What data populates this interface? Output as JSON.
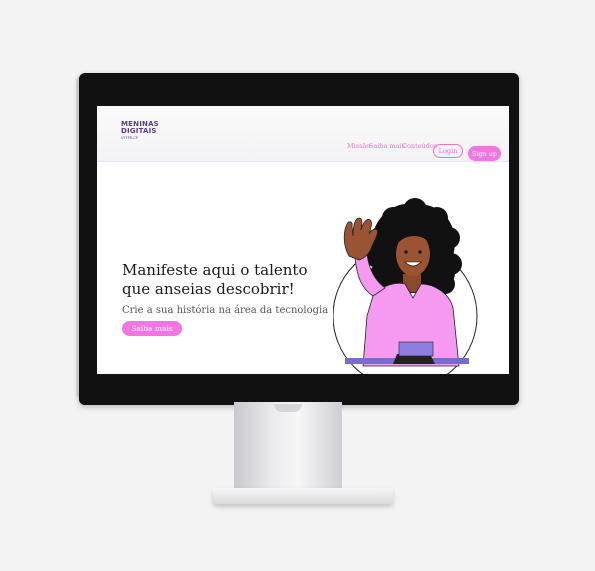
{
  "brand": {
    "line1": "MENINAS",
    "line2": "DIGITAIS",
    "line3": "UTFPR-CP"
  },
  "nav": {
    "links": [
      "Missão",
      "Saiba mais",
      "Conteúdos"
    ],
    "login": "Login",
    "signup": "Sign up"
  },
  "hero": {
    "title_line1": "Manifeste aqui o talento",
    "title_line2": "que anseias descobrir!",
    "subtitle": "Crie a sua história na área da tecnologia",
    "cta": "Saiba mais"
  },
  "colors": {
    "accent": "#f275e2",
    "brand": "#5b3a8e",
    "shirt": "#f59af0"
  },
  "illustration": {
    "icon": "waving-woman-illustration"
  }
}
